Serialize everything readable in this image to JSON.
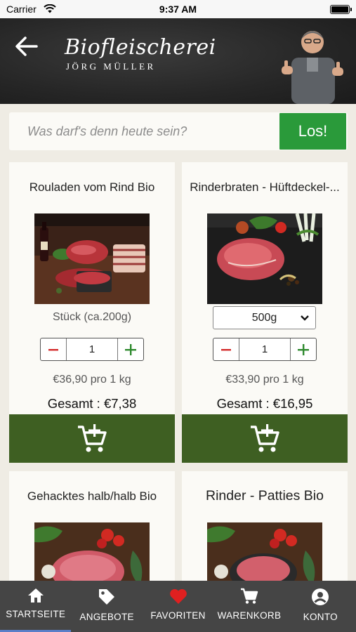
{
  "status": {
    "carrier": "Carrier",
    "time": "9:37 AM"
  },
  "header": {
    "brand_script": "Biofleischerei",
    "brand_sub": "JÖRG MÜLLER"
  },
  "search": {
    "placeholder": "Was darf's denn heute sein?",
    "button_label": "Los!"
  },
  "products": [
    {
      "title": "Rouladen vom Rind Bio",
      "unit": "Stück (ca.200g)",
      "quantity": "1",
      "price_per": "€36,90 pro 1 kg",
      "total": "Gesamt : €7,38"
    },
    {
      "title": "Rinderbraten - Hüftdeckel-...",
      "unit_select": "500g",
      "quantity": "1",
      "price_per": "€33,90 pro 1 kg",
      "total": "Gesamt : €16,95"
    },
    {
      "title": "Gehacktes halb/halb Bio"
    },
    {
      "title": "Rinder - Patties Bio"
    }
  ],
  "nav": [
    {
      "label": "STARTSEITE",
      "icon": "home-icon"
    },
    {
      "label": "ANGEBOTE",
      "icon": "tag-icon"
    },
    {
      "label": "FAVORITEN",
      "icon": "heart-icon"
    },
    {
      "label": "WARENKORB",
      "icon": "cart-icon"
    },
    {
      "label": "KONTO",
      "icon": "account-icon"
    }
  ],
  "colors": {
    "accent_green": "#2a9a3a",
    "cart_green": "#3e5f22",
    "nav_bg": "#454545",
    "favorite_red": "#e02020",
    "underline_blue": "#5b7fc9"
  }
}
